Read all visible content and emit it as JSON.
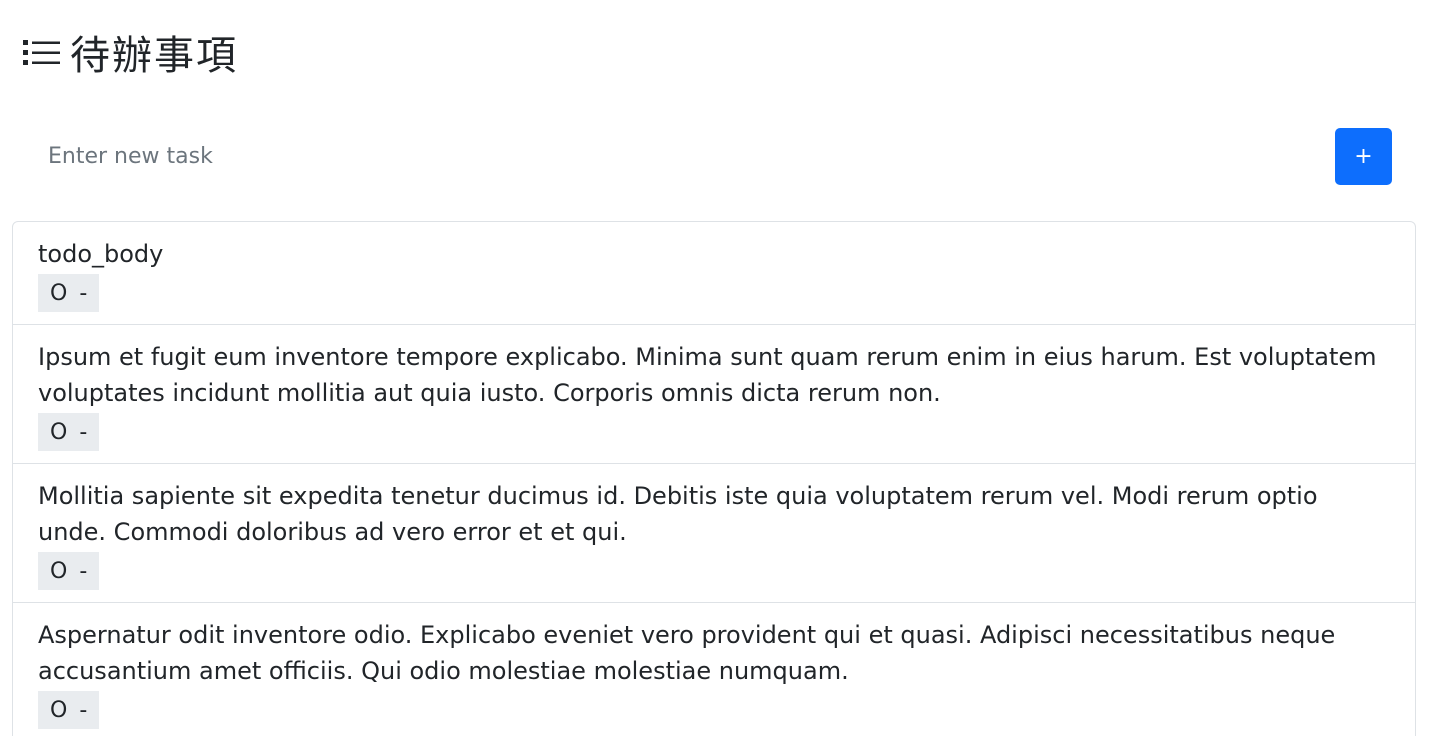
{
  "header": {
    "title": "待辦事項"
  },
  "new_task": {
    "placeholder": "Enter new task",
    "value": "",
    "add_label": "+"
  },
  "todos": [
    {
      "body": "todo_body",
      "complete_label": "O",
      "delete_label": "-"
    },
    {
      "body": "Ipsum et fugit eum inventore tempore explicabo. Minima sunt quam rerum enim in eius harum. Est voluptatem voluptates incidunt mollitia aut quia iusto. Corporis omnis dicta rerum non.",
      "complete_label": "O",
      "delete_label": "-"
    },
    {
      "body": "Mollitia sapiente sit expedita tenetur ducimus id. Debitis iste quia voluptatem rerum vel. Modi rerum optio unde. Commodi doloribus ad vero error et et qui.",
      "complete_label": "O",
      "delete_label": "-"
    },
    {
      "body": "Aspernatur odit inventore odio. Explicabo eveniet vero provident qui et quasi. Adipisci necessitatibus neque accusantium amet officiis. Qui odio molestiae molestiae numquam.",
      "complete_label": "O",
      "delete_label": "-"
    }
  ],
  "colors": {
    "primary": "#0d6efd",
    "border": "#dee2e6",
    "action_bg": "#e9ecef"
  },
  "icons": {
    "header": "list-icon"
  }
}
